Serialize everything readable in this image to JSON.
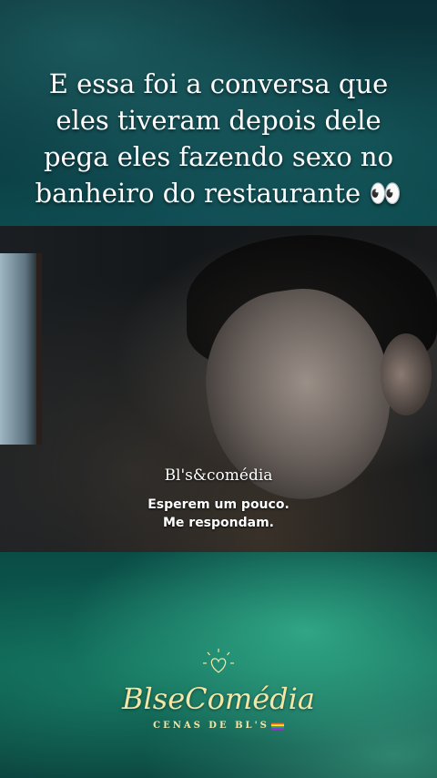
{
  "headline": {
    "line1": "E essa foi a conversa que",
    "line2": "eles tiveram depois dele",
    "line3": "pega eles fazendo sexo no",
    "line4": "banheiro do restaurante 👀"
  },
  "video": {
    "watermark": "Bl's&comédia",
    "subtitle_line1": "Esperem um pouco.",
    "subtitle_line2": "Me respondam."
  },
  "logo": {
    "title": "BlseComédia",
    "subtitle": "CENAS DE BL'S"
  }
}
